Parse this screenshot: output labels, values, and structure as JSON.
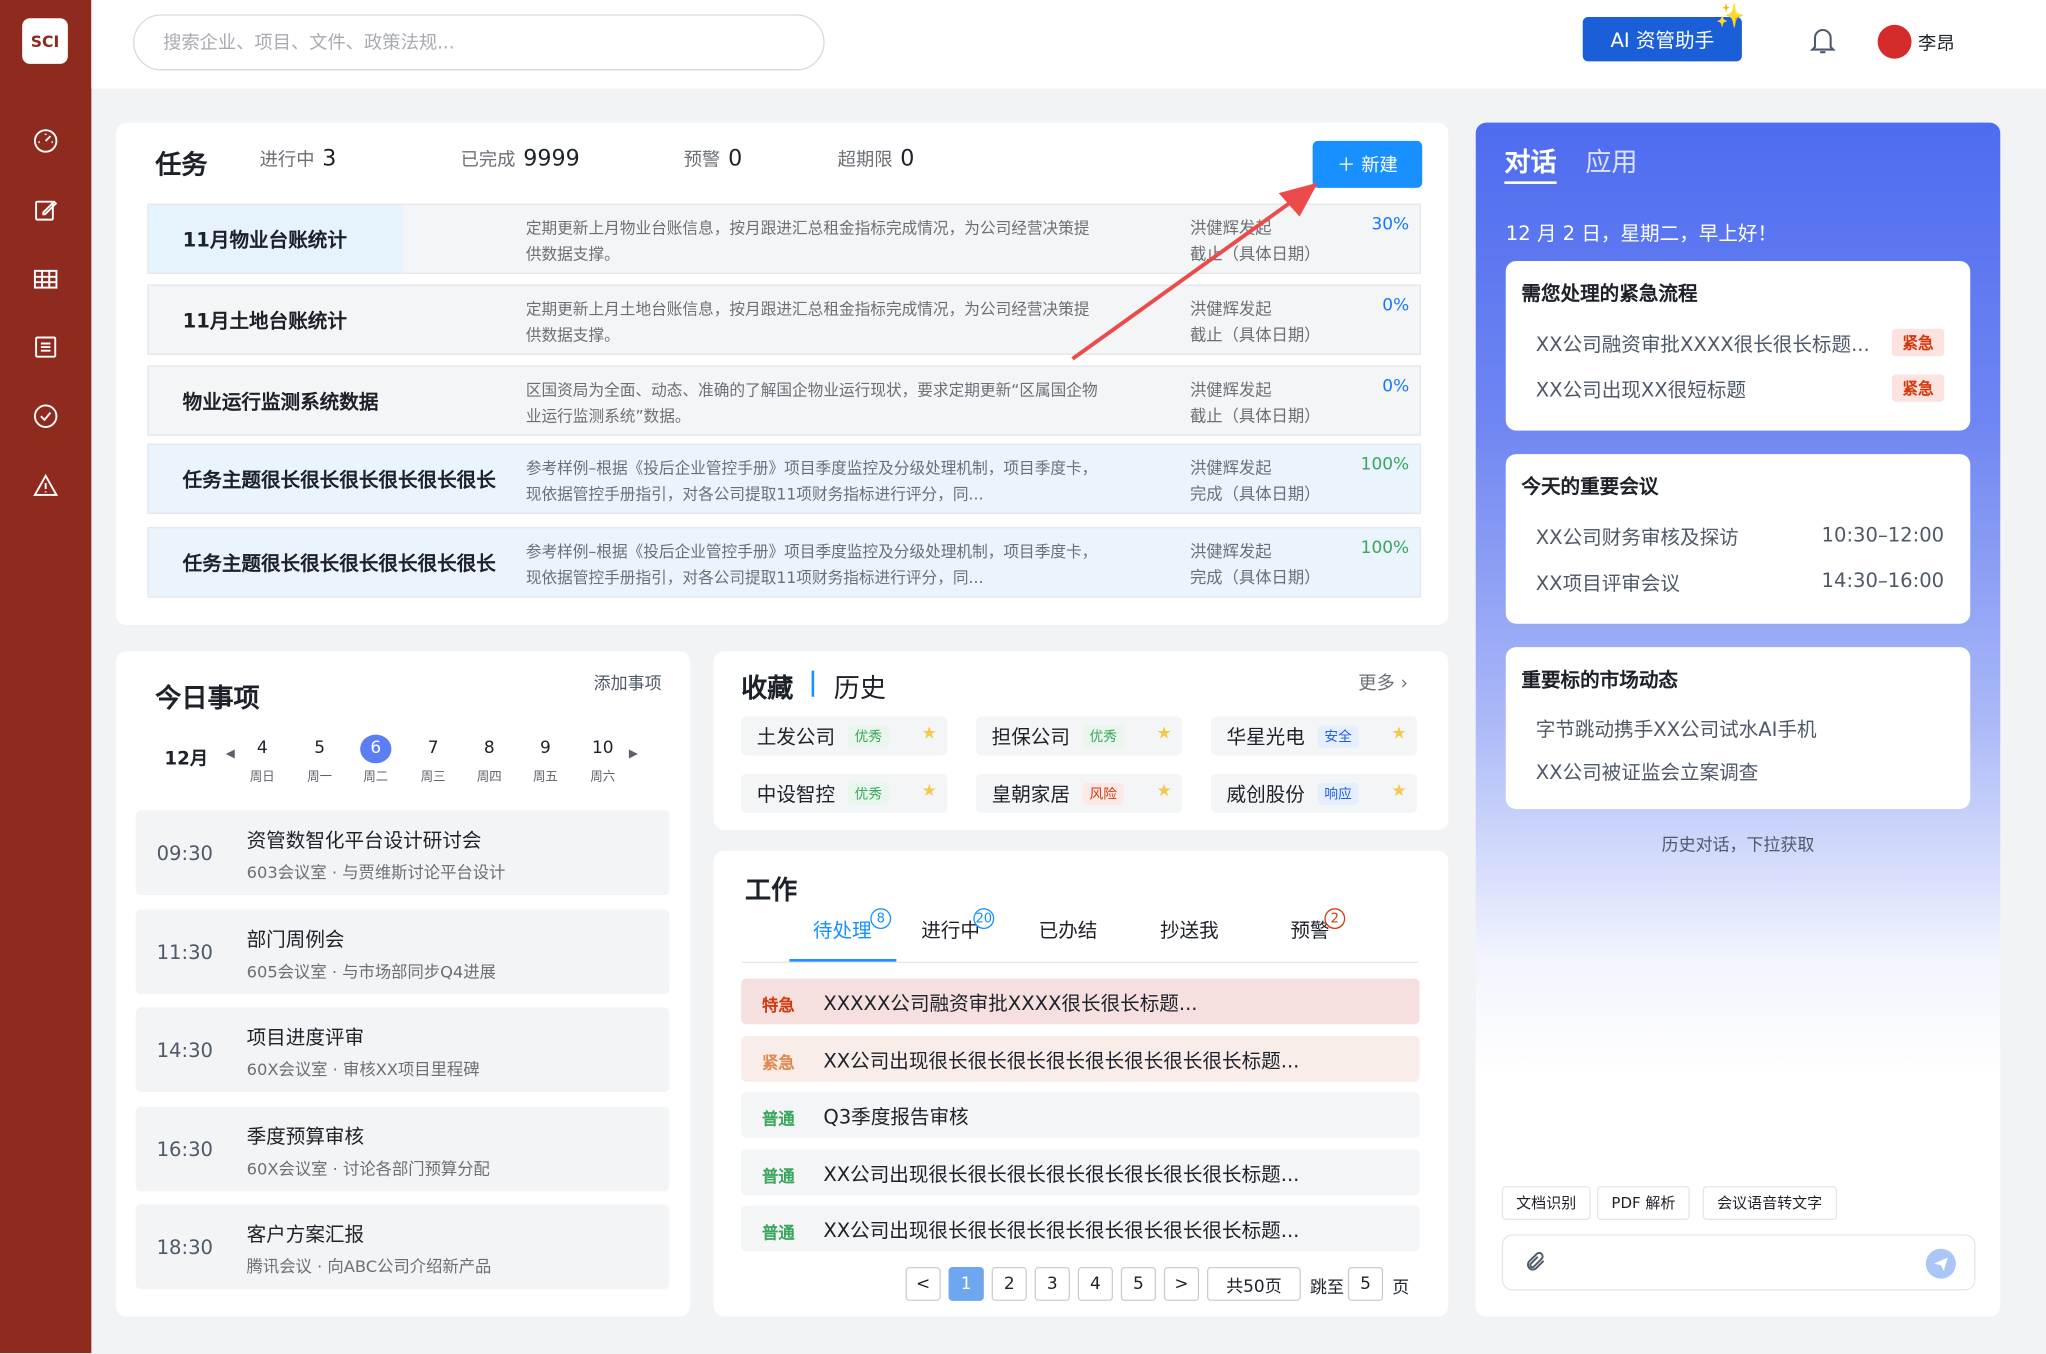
{
  "app": {
    "logo": "SCI",
    "user_name": "李昂",
    "ai_button": "AI 资管助手",
    "accent": "#1890ff",
    "sidebar_color": "#8f2a1f"
  },
  "search": {
    "placeholder": "搜索企业、项目、文件、政策法规..."
  },
  "sidebar": {
    "icons": [
      "dashboard-icon",
      "edit-icon",
      "table-icon",
      "list-icon",
      "check-circle-icon",
      "warning-icon"
    ]
  },
  "tasks": {
    "title": "任务",
    "stats": [
      {
        "label": "进行中",
        "value": "3"
      },
      {
        "label": "已完成",
        "value": "9999"
      },
      {
        "label": "预警",
        "value": "0"
      },
      {
        "label": "超期限",
        "value": "0"
      }
    ],
    "new_label": "＋ 新建",
    "rows": [
      {
        "title": "11月物业台账统计",
        "desc": "定期更新上月物业台账信息，按月跟进汇总租金指标完成情况，为公司经营决策提供数据支撑。",
        "who": "洪健辉发起",
        "status": "截止（具体日期）",
        "progress": "30%"
      },
      {
        "title": "11月土地台账统计",
        "desc": "定期更新上月土地台账信息，按月跟进汇总租金指标完成情况，为公司经营决策提供数据支撑。",
        "who": "洪健辉发起",
        "status": "截止（具体日期）",
        "progress": "0%"
      },
      {
        "title": "物业运行监测系统数据",
        "desc": "区国资局为全面、动态、准确的了解国企物业运行现状，要求定期更新“区属国企物业运行监测系统”数据。",
        "who": "洪健辉发起",
        "status": "截止（具体日期）",
        "progress": "0%"
      },
      {
        "title": "任务主题很长很长很长很长很长很长",
        "desc": "参考样例–根据《投后企业管控手册》项目季度监控及分级处理机制，项目季度卡，现依据管控手册指引，对各公司提取11项财务指标进行评分，同...",
        "who": "洪健辉发起",
        "status": "完成（具体日期）",
        "progress": "100%"
      },
      {
        "title": "任务主题很长很长很长很长很长很长",
        "desc": "参考样例–根据《投后企业管控手册》项目季度监控及分级处理机制，项目季度卡，现依据管控手册指引，对各公司提取11项财务指标进行评分，同...",
        "who": "洪健辉发起",
        "status": "完成（具体日期）",
        "progress": "100%"
      }
    ]
  },
  "today": {
    "title": "今日事项",
    "add_label": "添加事项",
    "month": "12月",
    "days": [
      {
        "n": "4",
        "w": "周日"
      },
      {
        "n": "5",
        "w": "周一"
      },
      {
        "n": "6",
        "w": "周二"
      },
      {
        "n": "7",
        "w": "周三"
      },
      {
        "n": "8",
        "w": "周四"
      },
      {
        "n": "9",
        "w": "周五"
      },
      {
        "n": "10",
        "w": "周六"
      }
    ],
    "events": [
      {
        "time": "09:30",
        "title": "资管数智化平台设计研讨会",
        "sub": "603会议室 · 与贾维斯讨论平台设计"
      },
      {
        "time": "11:30",
        "title": "部门周例会",
        "sub": "605会议室 · 与市场部同步Q4进展"
      },
      {
        "time": "14:30",
        "title": "项目进度评审",
        "sub": "60X会议室 · 审核XX项目里程碑"
      },
      {
        "time": "16:30",
        "title": "季度预算审核",
        "sub": "60X会议室 · 讨论各部门预算分配"
      },
      {
        "time": "18:30",
        "title": "客户方案汇报",
        "sub": "腾讯会议 · 向ABC公司介绍新产品"
      }
    ]
  },
  "favorites": {
    "tab1": "收藏",
    "tab2": "历史",
    "more": "更多",
    "items": [
      {
        "name": "土发公司",
        "tag": "优秀"
      },
      {
        "name": "担保公司",
        "tag": "优秀"
      },
      {
        "name": "华星光电",
        "tag": "安全"
      },
      {
        "name": "中设智控",
        "tag": "优秀"
      },
      {
        "name": "皇朝家居",
        "tag": "风险"
      },
      {
        "name": "威创股份",
        "tag": "响应"
      }
    ]
  },
  "work": {
    "title": "工作",
    "tabs": [
      {
        "label": "待处理",
        "badge": "8"
      },
      {
        "label": "进行中",
        "badge": "20"
      },
      {
        "label": "已办结",
        "badge": ""
      },
      {
        "label": "抄送我",
        "badge": ""
      },
      {
        "label": "预警",
        "badge": "2"
      }
    ],
    "rows": [
      {
        "level": "特急",
        "title": "XXXXX公司融资审批XXXX很长很长标题..."
      },
      {
        "level": "紧急",
        "title": "XX公司出现很长很长很长很长很长很长很长很长标题..."
      },
      {
        "level": "普通",
        "title": "Q3季度报告审核"
      },
      {
        "level": "普通",
        "title": "XX公司出现很长很长很长很长很长很长很长很长标题..."
      },
      {
        "level": "普通",
        "title": "XX公司出现很长很长很长很长很长很长很长很长标题..."
      }
    ],
    "pagination": {
      "prev": "<",
      "pages": [
        "1",
        "2",
        "3",
        "4",
        "5"
      ],
      "next": ">",
      "total": "共50页",
      "jump": "跳至",
      "jump_value": "5",
      "unit": "页"
    }
  },
  "chat": {
    "tab1": "对话",
    "tab2": "应用",
    "greeting": "12 月 2 日，星期二，早上好！",
    "urgent": {
      "title": "需您处理的紧急流程",
      "items": [
        {
          "text": "XX公司融资审批XXXX很长很长标题...",
          "tag": "紧急"
        },
        {
          "text": "XX公司出现XX很短标题",
          "tag": "紧急"
        }
      ]
    },
    "meetings": {
      "title": "今天的重要会议",
      "items": [
        {
          "text": "XX公司财务审核及探访",
          "time": "10:30–12:00"
        },
        {
          "text": "XX项目评审会议",
          "time": "14:30–16:00"
        }
      ]
    },
    "market": {
      "title": "重要标的市场动态",
      "items": [
        "字节跳动携手XX公司试水AI手机",
        "XX公司被证监会立案调查"
      ]
    },
    "history_hint": "历史对话，下拉获取",
    "tools": [
      "文档识别",
      "PDF 解析",
      "会议语音转文字"
    ]
  }
}
